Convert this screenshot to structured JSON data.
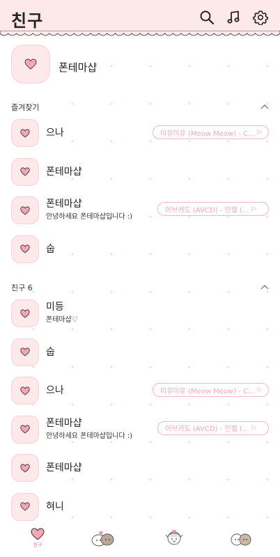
{
  "header": {
    "title": "친구",
    "icons": [
      "search-icon",
      "music-note-icon",
      "settings-gear-icon"
    ]
  },
  "profile": {
    "name": "폰테마샵"
  },
  "favorites": {
    "label": "즐겨찾기",
    "items": [
      {
        "name": "으나",
        "status": "",
        "music": "미유미유 (Meow Meow) - C..."
      },
      {
        "name": "폰테마샵",
        "status": "",
        "music": ""
      },
      {
        "name": "폰테마샵",
        "status": "안녕하세요 폰테마샵입니다 :)",
        "music": "아브카도 (AVCD) - 민켈 (..."
      },
      {
        "name": "숩",
        "status": "",
        "music": ""
      }
    ]
  },
  "friends": {
    "label": "친구 6",
    "items": [
      {
        "name": "미등",
        "status": "폰테마샵♡",
        "music": ""
      },
      {
        "name": "숩",
        "status": "",
        "music": ""
      },
      {
        "name": "으나",
        "status": "",
        "music": "미유미유 (Meow Meow) - C..."
      },
      {
        "name": "폰테마샵",
        "status": "안녕하세요 폰테마샵입니다 :)",
        "music": "아브카도 (AVCD) - 민켈 (..."
      },
      {
        "name": "폰테마샵",
        "status": "",
        "music": ""
      },
      {
        "name": "혀니",
        "status": "",
        "music": ""
      }
    ]
  },
  "tabbar": {
    "active_label": "친구",
    "tabs": [
      "friends-tab",
      "chats-tab",
      "view-tab",
      "more-tab"
    ]
  },
  "colors": {
    "accent": "#f5b9c2",
    "header_bg": "#fde8ea",
    "heart": "#f4a6b2"
  }
}
